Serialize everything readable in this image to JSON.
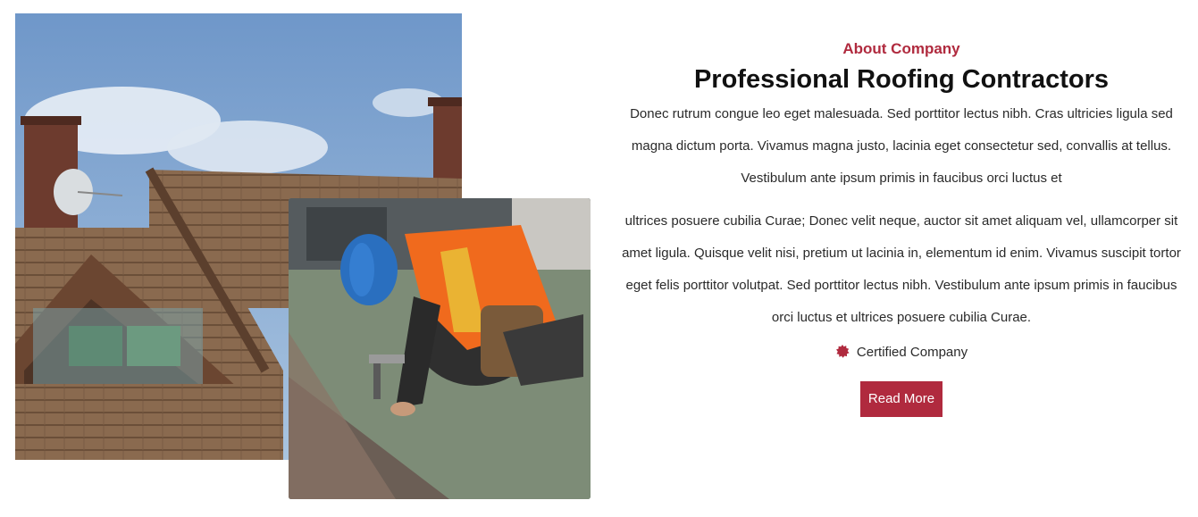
{
  "about": {
    "eyebrow": "About Company",
    "title": "Professional Roofing Contractors",
    "paragraph_1": "Donec rutrum congue leo eget malesuada. Sed porttitor lectus nibh. Cras ultricies ligula sed magna dictum porta. Vivamus magna justo, lacinia eget consectetur sed, convallis at tellus. Vestibulum ante ipsum primis in faucibus orci luctus et",
    "paragraph_2": "ultrices posuere cubilia Curae; Donec velit neque, auctor sit amet aliquam vel, ullamcorper sit amet ligula. Quisque velit nisi, pretium ut lacinia in, elementum id enim. Vivamus suscipit tortor eget felis porttitor volutpat. Sed porttitor lectus nibh. Vestibulum ante ipsum primis in faucibus orci luctus et ultrices posuere cubilia Curae.",
    "certified_label": "Certified Company",
    "certified_icon": "badge-icon",
    "read_more_label": "Read More"
  },
  "images": {
    "house": "house-roof-photo",
    "roofer": "roofer-working-photo"
  },
  "colors": {
    "accent": "#b02a3e",
    "heading": "#111111",
    "body_text": "#2a2a2a"
  }
}
